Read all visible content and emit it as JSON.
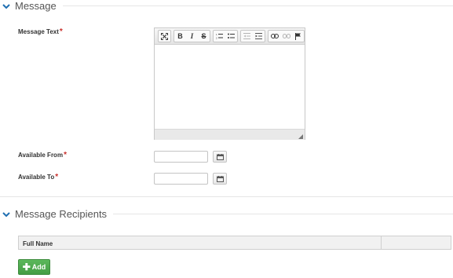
{
  "sections": {
    "message": "Message",
    "recipients": "Message Recipients"
  },
  "fields": {
    "message_text": "Message Text",
    "available_from": "Available From",
    "available_to": "Available To",
    "required_mark": "*"
  },
  "editor": {
    "toolbar": [
      "maximize-icon",
      "bold",
      "italic",
      "strikethrough",
      "numbered-list-icon",
      "bulleted-list-icon",
      "outdent-icon",
      "indent-icon",
      "link-icon",
      "unlink-icon",
      "anchor-icon"
    ],
    "bold": "B",
    "italic": "I",
    "strike": "S"
  },
  "grid": {
    "columns": [
      "Full Name",
      ""
    ]
  },
  "buttons": {
    "add": "Add"
  },
  "colors": {
    "accent_blue": "#1f6fb2",
    "required_red": "#c9302c",
    "add_green": "#5cb85c"
  }
}
